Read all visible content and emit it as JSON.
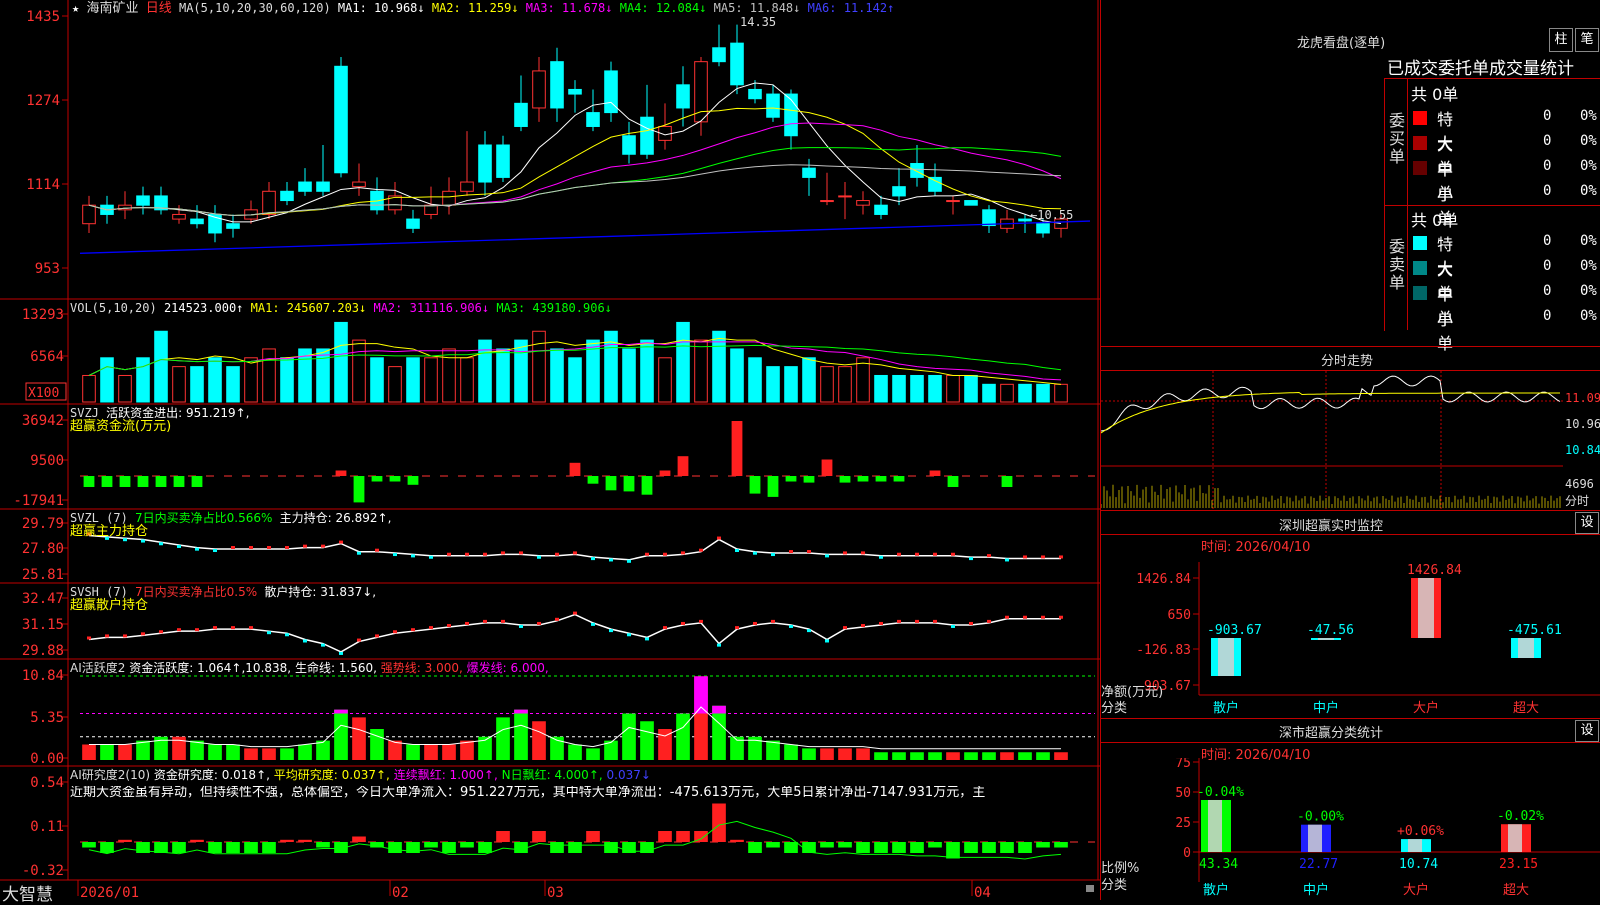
{
  "stock": {
    "name": "海南矿业",
    "period": "日线",
    "star": "★"
  },
  "main_header": {
    "ma": "MA(5,10,20,30,60,120)",
    "ma1": "MA1: 10.968↓",
    "ma2": "MA2: 11.259↓",
    "ma3": "MA3: 11.678↓",
    "ma4": "MA4: 12.084↓",
    "ma5": "MA5: 11.848↓",
    "ma6": "MA6: 11.142↑",
    "high_mark": "14.35",
    "low_mark": "←10.55"
  },
  "vol_header": {
    "name": "VOL(5,10,20)",
    "v": "214523.000↑",
    "ma1": "MA1: 245607.203↓",
    "ma2": "MA2: 311116.906↓",
    "ma3": "MA3: 439180.906↓",
    "unit": "X100"
  },
  "svzj_header": {
    "name": "SVZJ",
    "text": "活跃资金进出: 951.219↑,",
    "sub": "超赢资金流(万元)"
  },
  "svzl_header": {
    "name": "SVZL (7)",
    "t1": "7日内买卖净占比0.566%",
    "t2": "主力持仓: 26.892↑,",
    "sub": "超赢主力持仓"
  },
  "svsh_header": {
    "name": "SVSH (7)",
    "t1": "7日内买卖净占比0.5%",
    "t2": "散户持仓: 31.837↓,",
    "sub": "超赢散户持仓"
  },
  "ai_header": {
    "name": "AI活跃度2",
    "t1": "资金活跃度: 1.064↑,10.838,",
    "t2": "生命线: 1.560,",
    "t3": "强势线: 3.000,",
    "t4": "爆发线: 6.000,"
  },
  "ai2_header": {
    "name": "AI研究度2(10)",
    "t1": "资金研究度: 0.018↑,",
    "t2": "平均研究度: 0.037↑,",
    "t3": "连续飘红: 1.000↑,",
    "t4": "N日飘红: 4.000↑,",
    "t5": "0.037↓",
    "comment": "近期大资金虽有异动，但持续性不强，总体偏空，今日大单净流入：951.227万元，其中特大单净流出：-475.613万元，大单5日累计净出-7147.931万元，主"
  },
  "y_axes": {
    "main": [
      "1435",
      "1274",
      "1114",
      "953"
    ],
    "vol": [
      "13293",
      "6564",
      "X100"
    ],
    "svzj": [
      "36942",
      "9500",
      "-17941"
    ],
    "svzl": [
      "29.79",
      "27.80",
      "25.81"
    ],
    "svsh": [
      "32.47",
      "31.15",
      "29.88"
    ],
    "ai": [
      "10.84",
      "5.35",
      "0.00"
    ],
    "ai2": [
      "0.54",
      "0.11",
      "-0.32"
    ]
  },
  "x_axis": [
    "2026/01",
    "02",
    "03",
    "04"
  ],
  "brand": "大智慧",
  "right": {
    "title": "龙虎看盘(逐单)",
    "btn1": "柱",
    "btn2": "笔",
    "stat_title": "已成交委托单成交量统计",
    "buy_total": "共 0单",
    "sell_total": "共 0单",
    "buy_label": "委买单",
    "sell_label": "委卖单",
    "buy_rows": [
      {
        "name": "特大",
        "v": "0",
        "p": "0%",
        "color": "#ff0000"
      },
      {
        "name": "大单",
        "v": "0",
        "p": "0%",
        "color": "#aa0000"
      },
      {
        "name": "中单",
        "v": "0",
        "p": "0%",
        "color": "#660000"
      },
      {
        "name": "小单",
        "v": "0",
        "p": "0%",
        "color": "#000000"
      }
    ],
    "sell_rows": [
      {
        "name": "特大",
        "v": "0",
        "p": "0%",
        "color": "#00ffff"
      },
      {
        "name": "大单",
        "v": "0",
        "p": "0%",
        "color": "#008888"
      },
      {
        "name": "中单",
        "v": "0",
        "p": "0%",
        "color": "#006666"
      },
      {
        "name": "小单",
        "v": "0",
        "p": "0%",
        "color": "#000000"
      }
    ],
    "intraday_title": "分时走势",
    "intraday_labels": [
      "11.09",
      "10.96",
      "10.84",
      "4696",
      "分时"
    ],
    "sz_title": "深圳超赢实时监控",
    "sz_set": "设",
    "sz_time": "时间: 2026/04/10",
    "sz_y": [
      "1426.84",
      "650",
      "-126.83",
      "-903.67"
    ],
    "sz_values": [
      {
        "label": "-903.67",
        "cat": "散户",
        "v": -903.67
      },
      {
        "label": "-47.56",
        "cat": "中户",
        "v": -47.56
      },
      {
        "label": "1426.84",
        "cat": "大户",
        "v": 1426.84
      },
      {
        "label": "-475.61",
        "cat": "超大",
        "v": -475.61
      }
    ],
    "sz_unit": "净额(万元)",
    "sz_cat": "分类",
    "ss_title": "深市超赢分类统计",
    "ss_set": "设",
    "ss_time": "时间: 2026/04/10",
    "ss_y": [
      "75",
      "50",
      "25",
      "0"
    ],
    "ss_values": [
      {
        "top": "-0.04%",
        "val": "43.34",
        "cat": "散户",
        "v": 43.34
      },
      {
        "top": "-0.00%",
        "val": "22.77",
        "cat": "中户",
        "v": 22.77
      },
      {
        "top": "+0.06%",
        "val": "10.74",
        "cat": "大户",
        "v": 10.74
      },
      {
        "top": "-0.02%",
        "val": "23.15",
        "cat": "超大",
        "v": 23.15
      }
    ],
    "ss_unit": "比例%",
    "ss_cat": "分类"
  },
  "colors": {
    "up": "#ff3232",
    "down": "#00ffff",
    "grid": "#c00000",
    "ma1": "#ffffff",
    "ma2": "#ffff00",
    "ma3": "#ff00ff",
    "ma4": "#00ff00",
    "ma5": "#c0c0c0",
    "ma6": "#0000ff"
  },
  "chart_data": {
    "type": "candlestick",
    "x_labels": [
      "2026/01",
      "02",
      "03",
      "04"
    ],
    "candles": [
      [
        1.0,
        1.2,
        1.3,
        0.9
      ],
      [
        1.2,
        1.1,
        1.3,
        1.0
      ],
      [
        1.15,
        1.2,
        1.35,
        1.05
      ],
      [
        1.3,
        1.2,
        1.4,
        1.1
      ],
      [
        1.3,
        1.15,
        1.4,
        1.1
      ],
      [
        1.05,
        1.1,
        1.2,
        1.0
      ],
      [
        1.05,
        1.0,
        1.2,
        0.95
      ],
      [
        1.1,
        0.9,
        1.2,
        0.8
      ],
      [
        1.0,
        0.95,
        1.1,
        0.85
      ],
      [
        1.05,
        1.15,
        1.25,
        1.0
      ],
      [
        1.1,
        1.35,
        1.45,
        1.05
      ],
      [
        1.35,
        1.25,
        1.45,
        1.2
      ],
      [
        1.45,
        1.35,
        1.6,
        1.3
      ],
      [
        1.45,
        1.35,
        1.85,
        1.3
      ],
      [
        2.7,
        1.55,
        2.8,
        1.5
      ],
      [
        1.4,
        1.45,
        1.65,
        1.3
      ],
      [
        1.35,
        1.15,
        1.5,
        1.1
      ],
      [
        1.15,
        1.3,
        1.45,
        1.1
      ],
      [
        1.05,
        0.95,
        1.15,
        0.9
      ],
      [
        1.1,
        1.2,
        1.4,
        1.05
      ],
      [
        1.2,
        1.35,
        1.5,
        1.1
      ],
      [
        1.35,
        1.45,
        2.0,
        1.3
      ],
      [
        1.85,
        1.45,
        2.0,
        1.3
      ],
      [
        1.85,
        1.5,
        1.95,
        1.45
      ],
      [
        2.3,
        2.05,
        2.6,
        2.0
      ],
      [
        2.25,
        2.65,
        2.8,
        2.1
      ],
      [
        2.75,
        2.25,
        2.9,
        2.1
      ],
      [
        2.45,
        2.4,
        2.55,
        2.2
      ],
      [
        2.2,
        2.05,
        2.45,
        2.0
      ],
      [
        2.65,
        2.2,
        2.75,
        2.1
      ],
      [
        1.95,
        1.75,
        2.1,
        1.65
      ],
      [
        2.15,
        1.75,
        2.5,
        1.7
      ],
      [
        1.9,
        2.05,
        2.3,
        1.8
      ],
      [
        2.5,
        2.25,
        2.7,
        2.05
      ],
      [
        2.1,
        2.75,
        2.8,
        1.95
      ],
      [
        2.9,
        2.75,
        3.15,
        2.7
      ],
      [
        2.95,
        2.5,
        3.15,
        2.4
      ],
      [
        2.45,
        2.35,
        2.55,
        2.3
      ],
      [
        2.4,
        2.15,
        2.5,
        2.1
      ],
      [
        2.4,
        1.95,
        2.45,
        1.8
      ],
      [
        1.6,
        1.5,
        1.7,
        1.3
      ],
      [
        1.25,
        1.25,
        1.55,
        1.2
      ],
      [
        1.3,
        1.3,
        1.45,
        1.05
      ],
      [
        1.2,
        1.25,
        1.35,
        1.1
      ],
      [
        1.2,
        1.1,
        1.3,
        1.05
      ],
      [
        1.4,
        1.3,
        1.6,
        1.2
      ],
      [
        1.65,
        1.5,
        1.85,
        1.4
      ],
      [
        1.5,
        1.35,
        1.65,
        1.3
      ],
      [
        1.25,
        1.25,
        1.3,
        1.1
      ],
      [
        1.25,
        1.2,
        1.25,
        1.2
      ],
      [
        1.15,
        0.98,
        1.2,
        0.9
      ],
      [
        0.95,
        1.05,
        1.15,
        0.9
      ],
      [
        1.05,
        1.03,
        1.1,
        0.9
      ],
      [
        1.0,
        0.9,
        1.05,
        0.85
      ],
      [
        0.95,
        1.05,
        1.1,
        0.85
      ]
    ],
    "volume": [
      3,
      5,
      3,
      5,
      8,
      4,
      4,
      5,
      4,
      5,
      6,
      5,
      6,
      6,
      9,
      7,
      5,
      4,
      5,
      5,
      6,
      5,
      7,
      6,
      7,
      8,
      6,
      5,
      7,
      8,
      6,
      7,
      5,
      9,
      7,
      8,
      6,
      5,
      4,
      4,
      5,
      4,
      4,
      5,
      3,
      3,
      3,
      3,
      3,
      3,
      2,
      2,
      2,
      2,
      2
    ],
    "svzj": [
      -1,
      -1,
      -1,
      -1,
      -1,
      -1,
      -1,
      0.1,
      0.1,
      0.1,
      0.1,
      0.1,
      0.1,
      0.1,
      0.5,
      -2.4,
      -0.5,
      -0.5,
      -0.8,
      0.1,
      0.1,
      0.1,
      0.1,
      0.1,
      0.1,
      0.1,
      0.1,
      1.2,
      -0.7,
      -1.3,
      -1.4,
      -1.7,
      0.5,
      1.8,
      0.1,
      0.1,
      5.0,
      -1.6,
      -1.9,
      -0.5,
      -0.6,
      1.5,
      -0.6,
      -0.5,
      -0.5,
      -0.5,
      0.1,
      0.5,
      -1.0,
      0.1,
      0.1,
      -1.0,
      0.1,
      0.1,
      0.1
    ],
    "svzl": [
      28.8,
      28.7,
      28.6,
      28.5,
      28.3,
      28.1,
      27.9,
      27.8,
      27.8,
      27.8,
      27.8,
      27.8,
      27.9,
      27.9,
      28.2,
      27.6,
      27.6,
      27.5,
      27.4,
      27.3,
      27.3,
      27.3,
      27.3,
      27.4,
      27.4,
      27.3,
      27.3,
      27.4,
      27.2,
      27.1,
      27.0,
      27.3,
      27.3,
      27.4,
      27.6,
      28.5,
      27.8,
      27.6,
      27.5,
      27.5,
      27.5,
      27.4,
      27.4,
      27.4,
      27.3,
      27.3,
      27.3,
      27.3,
      27.3,
      27.2,
      27.2,
      27.1,
      27.1,
      27.1,
      27.1
    ],
    "svsh": [
      30.5,
      30.6,
      30.6,
      30.7,
      30.8,
      30.9,
      30.9,
      31.0,
      31.0,
      31.0,
      30.9,
      30.8,
      30.5,
      30.3,
      29.9,
      30.4,
      30.6,
      30.8,
      30.9,
      31.0,
      31.1,
      31.2,
      31.3,
      31.3,
      31.2,
      31.2,
      31.4,
      31.7,
      31.3,
      31.0,
      30.8,
      30.6,
      31.0,
      31.2,
      31.3,
      30.3,
      31.0,
      31.2,
      31.3,
      31.2,
      31.0,
      30.5,
      31.0,
      31.1,
      31.2,
      31.3,
      31.3,
      31.3,
      31.2,
      31.2,
      31.3,
      31.5,
      31.5,
      31.5,
      31.5
    ],
    "ai": [
      2,
      2,
      2,
      2.5,
      3,
      3,
      2.5,
      2,
      2,
      1.5,
      1.5,
      1.5,
      2,
      2.5,
      6.5,
      5.5,
      4,
      2.5,
      2,
      2,
      2,
      2.5,
      3,
      5.5,
      6.5,
      5,
      3,
      2,
      1.5,
      2.5,
      6,
      5,
      4,
      6,
      10.8,
      7,
      3,
      3,
      2.5,
      2,
      1.5,
      1.5,
      1.5,
      1.5,
      1,
      1,
      1,
      1,
      1,
      1,
      1,
      1,
      1,
      1,
      1
    ],
    "ai2": [
      -0.05,
      -0.1,
      0.02,
      -0.1,
      -0.1,
      -0.1,
      0.02,
      -0.1,
      -0.1,
      -0.1,
      -0.1,
      0.02,
      0.02,
      -0.05,
      -0.1,
      0.05,
      -0.05,
      -0.1,
      -0.1,
      -0.05,
      -0.1,
      -0.05,
      -0.1,
      0.1,
      -0.1,
      0.1,
      -0.1,
      -0.1,
      0.1,
      -0.1,
      -0.1,
      -0.1,
      0.1,
      0.1,
      0.1,
      0.35,
      0.02,
      -0.1,
      -0.05,
      -0.1,
      -0.1,
      -0.05,
      -0.05,
      -0.1,
      -0.1,
      -0.1,
      -0.1,
      -0.05,
      -0.15,
      -0.1,
      -0.1,
      -0.1,
      -0.1,
      -0.05,
      -0.05
    ]
  }
}
